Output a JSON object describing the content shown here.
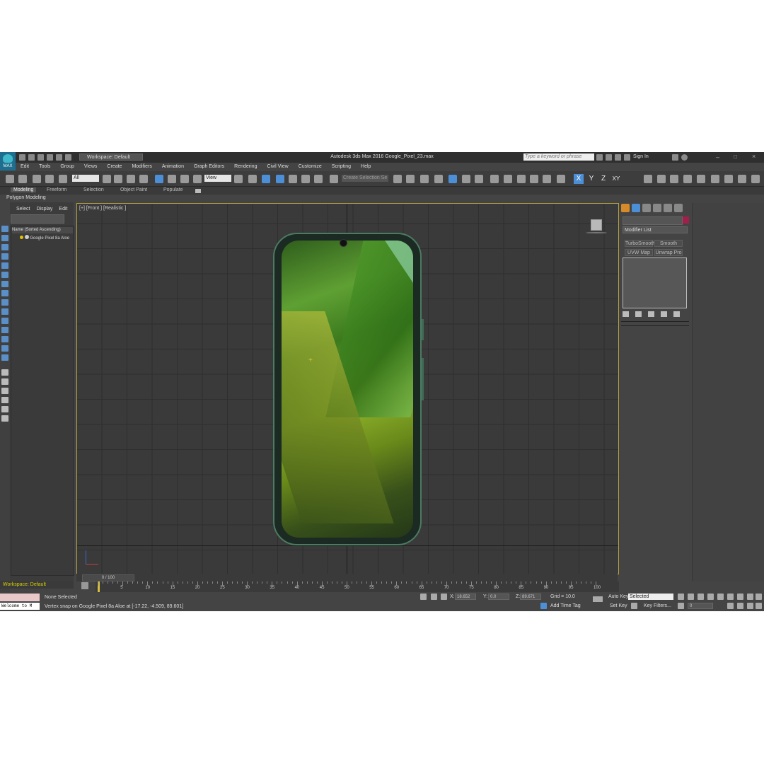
{
  "titlebar": {
    "workspace": "Workspace: Default",
    "title": "Autodesk 3ds Max 2016    Google_Pixel_23.max",
    "search_placeholder": "Type a keyword or phrase",
    "sign_in": "Sign In",
    "logo": "MAX"
  },
  "menu": [
    "Edit",
    "Tools",
    "Group",
    "Views",
    "Create",
    "Modifiers",
    "Animation",
    "Graph Editors",
    "Rendering",
    "Civil View",
    "Customize",
    "Scripting",
    "Help"
  ],
  "toolbar": {
    "filter": "All",
    "ref_coord": "View",
    "selection_set": "Create Selection Se",
    "axes": [
      "X",
      "Y",
      "Z",
      "XY"
    ]
  },
  "ribbon": {
    "tabs": [
      "Modeling",
      "Freeform",
      "Selection",
      "Object Paint",
      "Populate"
    ],
    "sub": "Polygon Modeling"
  },
  "scene_explorer": {
    "tabs": [
      "Select",
      "Display",
      "Edit"
    ],
    "header": "Name (Sorted Ascending)",
    "items": [
      "Google Pixel 8a Aloe"
    ]
  },
  "viewport": {
    "label": "[+] [Front ] [Realistic ]"
  },
  "command_panel": {
    "modifier_list": "Modifier List",
    "buttons": [
      "TurboSmooth",
      "Smooth",
      "UVW Map",
      "Unwrap Pro"
    ]
  },
  "timeline": {
    "frame": "0 / 100",
    "ticks": [
      "5",
      "10",
      "15",
      "20",
      "25",
      "30",
      "35",
      "40",
      "45",
      "50",
      "55",
      "60",
      "65",
      "70",
      "75",
      "80",
      "85",
      "90",
      "95",
      "100"
    ]
  },
  "status": {
    "workspace": "Workspace: Default",
    "selection": "None Selected",
    "prompt": "Vertex snap on Google Pixel 8a Aloe at [-17.22, -4.509, 89.601]",
    "welcome": "Welcome to M",
    "x_label": "X:",
    "x_value": "18.652",
    "y_label": "Y:",
    "y_value": "0.0",
    "z_label": "Z:",
    "z_value": "89.671",
    "grid": "Grid = 10.0",
    "add_time_tag": "Add Time Tag",
    "auto_key": "Auto Key",
    "set_key": "Set Key",
    "selected": "Selected",
    "key_filters": "Key Filters...",
    "frame_field": "0"
  },
  "colors": {
    "accent": "#4d8fd6",
    "viewport_border": "#b5a240",
    "swatch": "#a0204a"
  }
}
